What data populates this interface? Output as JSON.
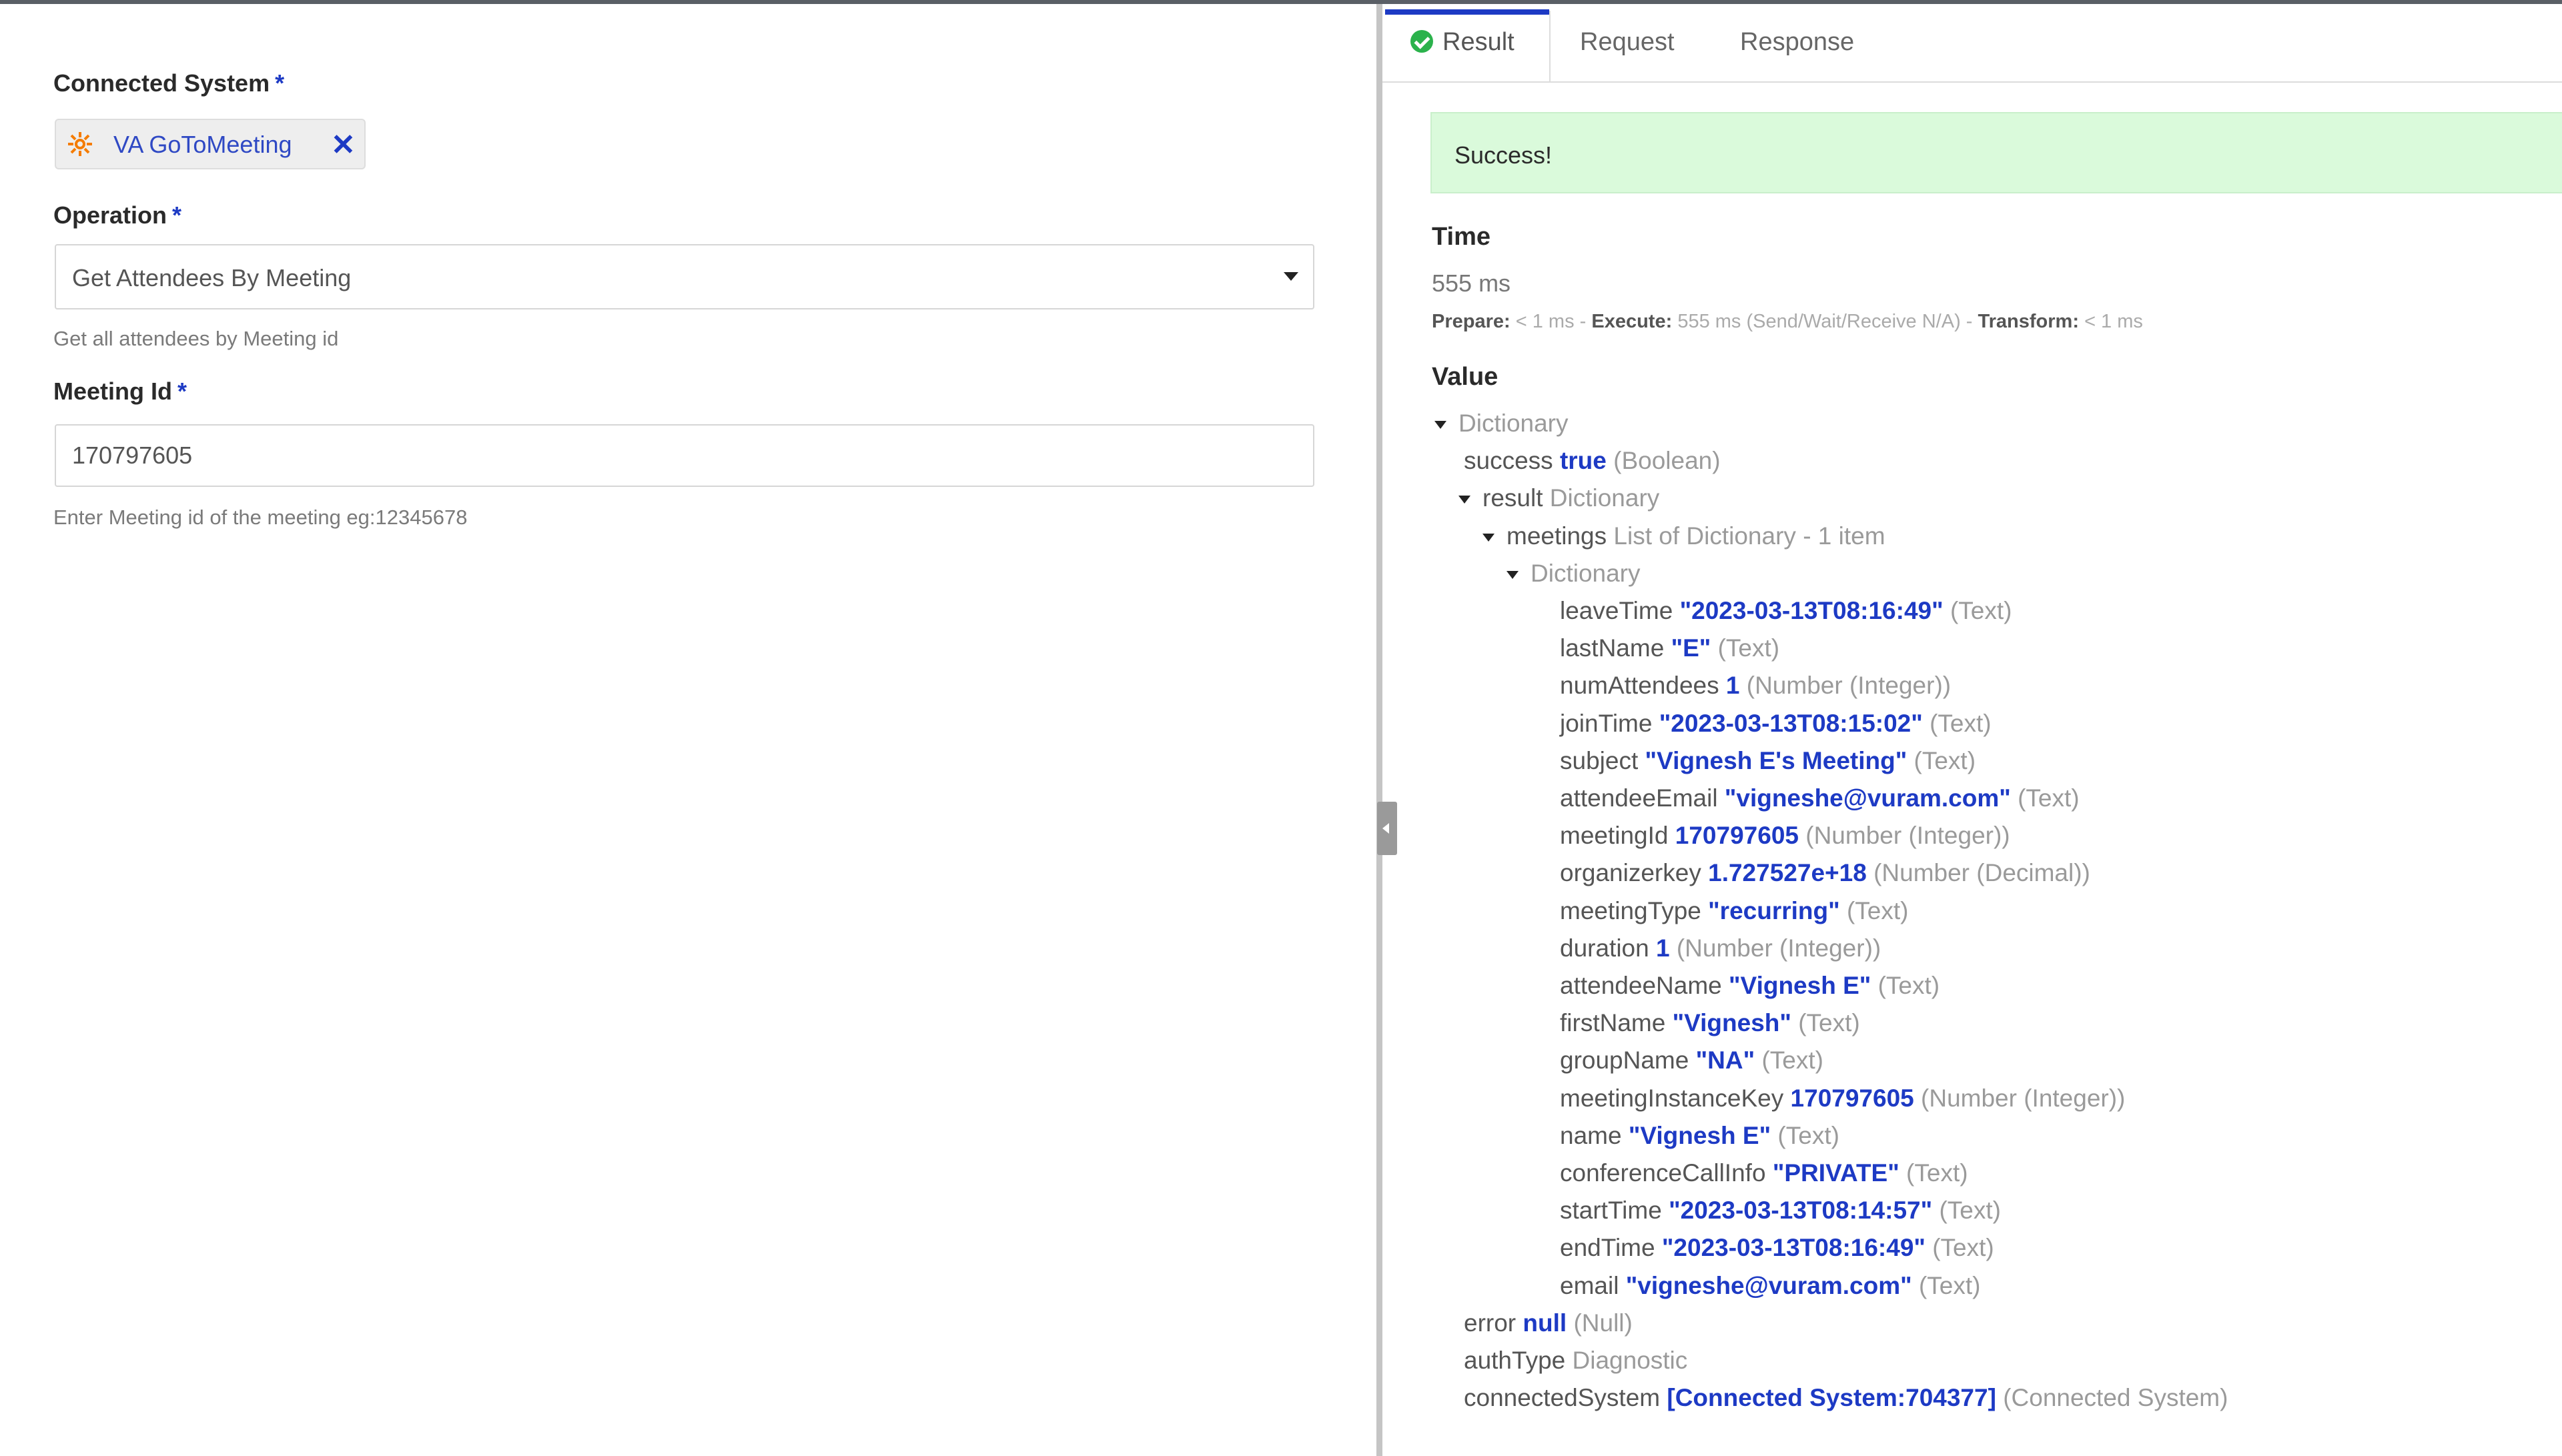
{
  "left": {
    "connected_system": {
      "label": "Connected System",
      "required": "*",
      "chip_text": "VA GoToMeeting",
      "close_glyph": "✕",
      "icon": "connected-system-icon"
    },
    "operation": {
      "label": "Operation",
      "required": "*",
      "selected": "Get Attendees By Meeting",
      "help": "Get all attendees by Meeting id"
    },
    "meeting_id": {
      "label": "Meeting Id",
      "required": "*",
      "value": "170797605",
      "help": "Enter Meeting id of the meeting eg:12345678"
    }
  },
  "right": {
    "tabs": [
      {
        "label": "Result",
        "active": true,
        "icon": "check-circle-icon"
      },
      {
        "label": "Request",
        "active": false
      },
      {
        "label": "Response",
        "active": false
      }
    ],
    "success_message": "Success!",
    "time": {
      "title": "Time",
      "value": "555 ms",
      "prepare_label": "Prepare:",
      "prepare_value": "< 1 ms",
      "execute_label": "Execute:",
      "execute_value": "555 ms (Send/Wait/Receive N/A)",
      "transform_label": "Transform:",
      "transform_value": "< 1 ms",
      "sep": " - "
    },
    "value": {
      "title": "Value",
      "rows": [
        {
          "key": "",
          "value": "",
          "type": "Dictionary",
          "expanded": true
        },
        {
          "key": "success",
          "value": "true",
          "type": "(Boolean)"
        },
        {
          "key": "result",
          "value": "",
          "type": "Dictionary",
          "expanded": true
        },
        {
          "key": "meetings",
          "value": "",
          "type": "List of Dictionary - 1 item",
          "expanded": true
        },
        {
          "key": "",
          "value": "",
          "type": "Dictionary",
          "expanded": true
        },
        {
          "key": "leaveTime",
          "value": "\"2023-03-13T08:16:49\"",
          "type": "(Text)"
        },
        {
          "key": "lastName",
          "value": "\"E\"",
          "type": "(Text)"
        },
        {
          "key": "numAttendees",
          "value": "1",
          "type": "(Number (Integer))"
        },
        {
          "key": "joinTime",
          "value": "\"2023-03-13T08:15:02\"",
          "type": "(Text)"
        },
        {
          "key": "subject",
          "value": "\"Vignesh E's Meeting\"",
          "type": "(Text)"
        },
        {
          "key": "attendeeEmail",
          "value": "\"vigneshe@vuram.com\"",
          "type": "(Text)"
        },
        {
          "key": "meetingId",
          "value": "170797605",
          "type": "(Number (Integer))"
        },
        {
          "key": "organizerkey",
          "value": "1.727527e+18",
          "type": "(Number (Decimal))"
        },
        {
          "key": "meetingType",
          "value": "\"recurring\"",
          "type": "(Text)"
        },
        {
          "key": "duration",
          "value": "1",
          "type": "(Number (Integer))"
        },
        {
          "key": "attendeeName",
          "value": "\"Vignesh E\"",
          "type": "(Text)"
        },
        {
          "key": "firstName",
          "value": "\"Vignesh\"",
          "type": "(Text)"
        },
        {
          "key": "groupName",
          "value": "\"NA\"",
          "type": "(Text)"
        },
        {
          "key": "meetingInstanceKey",
          "value": "170797605",
          "type": "(Number (Integer))"
        },
        {
          "key": "name",
          "value": "\"Vignesh E\"",
          "type": "(Text)"
        },
        {
          "key": "conferenceCallInfo",
          "value": "\"PRIVATE\"",
          "type": "(Text)"
        },
        {
          "key": "startTime",
          "value": "\"2023-03-13T08:14:57\"",
          "type": "(Text)"
        },
        {
          "key": "endTime",
          "value": "\"2023-03-13T08:16:49\"",
          "type": "(Text)"
        },
        {
          "key": "email",
          "value": "\"vigneshe@vuram.com\"",
          "type": "(Text)"
        },
        {
          "key": "error",
          "value": "null",
          "type": "(Null)"
        },
        {
          "key": "authType",
          "value": "",
          "type": "Diagnostic"
        },
        {
          "key": "connectedSystem",
          "value": "[Connected System:704377]",
          "type": "(Connected System)"
        }
      ]
    }
  },
  "colors": {
    "accent": "#1d3ac4",
    "success_bg": "#dafadb",
    "success_icon": "#2bb24c",
    "chip_icon": "#f57c00"
  }
}
